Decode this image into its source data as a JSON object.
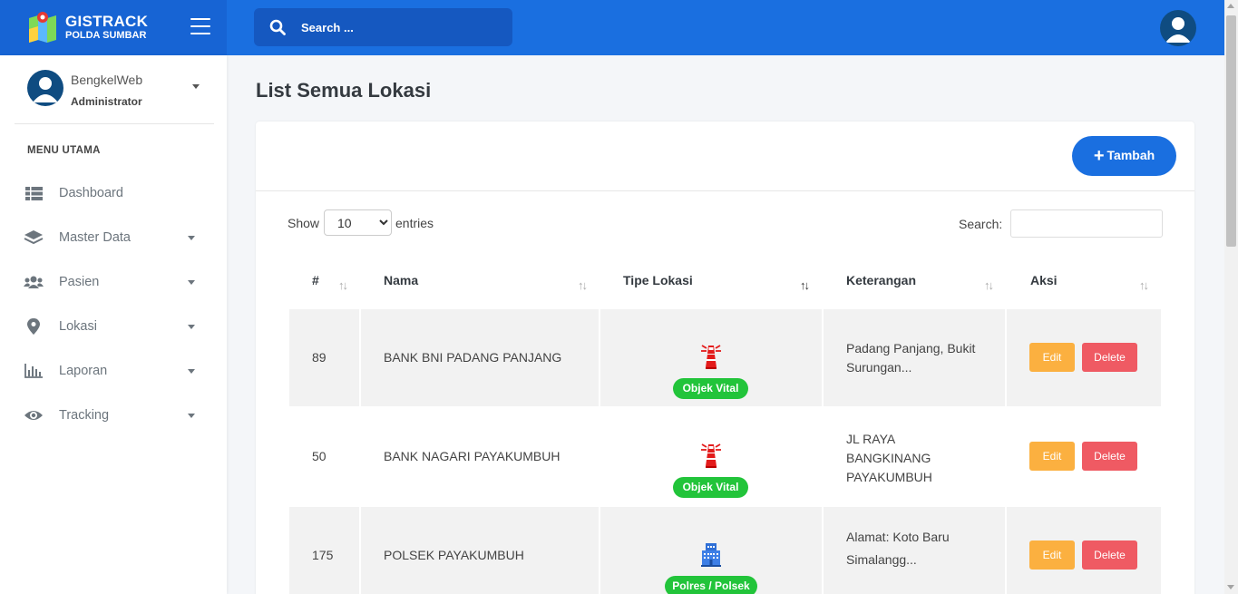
{
  "brand": {
    "title": "GISTRACK",
    "subtitle": "POLDA SUMBAR"
  },
  "search": {
    "placeholder": "Search ..."
  },
  "user": {
    "name": "BengkelWeb",
    "role": "Administrator"
  },
  "menu": {
    "header": "MENU UTAMA",
    "items": [
      {
        "label": "Dashboard",
        "icon": "table-icon"
      },
      {
        "label": "Master Data",
        "icon": "layers-icon"
      },
      {
        "label": "Pasien",
        "icon": "users-icon"
      },
      {
        "label": "Lokasi",
        "icon": "map-marker-icon"
      },
      {
        "label": "Laporan",
        "icon": "bar-chart-icon"
      },
      {
        "label": "Tracking",
        "icon": "eye-icon"
      }
    ]
  },
  "page": {
    "title": "List Semua Lokasi"
  },
  "toolbar": {
    "add_label": "Tambah"
  },
  "table_controls": {
    "show_label": "Show",
    "page_size": "10",
    "entries_label": "entries",
    "search_label": "Search:"
  },
  "table": {
    "columns": [
      "#",
      "Nama",
      "Tipe Lokasi",
      "Keterangan",
      "Aksi"
    ],
    "rows": [
      {
        "id": "89",
        "nama": "BANK BNI PADANG PANJANG",
        "tipe": "Objek Vital",
        "tipe_icon": "lighthouse-icon",
        "keterangan": [
          "Padang Panjang, Bukit",
          "Surungan..."
        ],
        "edit": "Edit",
        "delete": "Delete"
      },
      {
        "id": "50",
        "nama": "BANK NAGARI PAYAKUMBUH",
        "tipe": "Objek Vital",
        "tipe_icon": "lighthouse-icon",
        "keterangan": [
          "JL RAYA",
          "BANGKINANG",
          "PAYAKUMBUH"
        ],
        "edit": "Edit",
        "delete": "Delete"
      },
      {
        "id": "175",
        "nama": "POLSEK PAYAKUMBUH",
        "tipe": "Polres / Polsek",
        "tipe_icon": "police-building-icon",
        "keterangan": [
          "Alamat: Koto Baru",
          "Simalangg..."
        ],
        "edit": "Edit",
        "delete": "Delete"
      }
    ]
  },
  "colors": {
    "primary": "#1a6fe0",
    "success": "#22c43a",
    "warning": "#fbb040",
    "danger": "#ef5a63"
  }
}
